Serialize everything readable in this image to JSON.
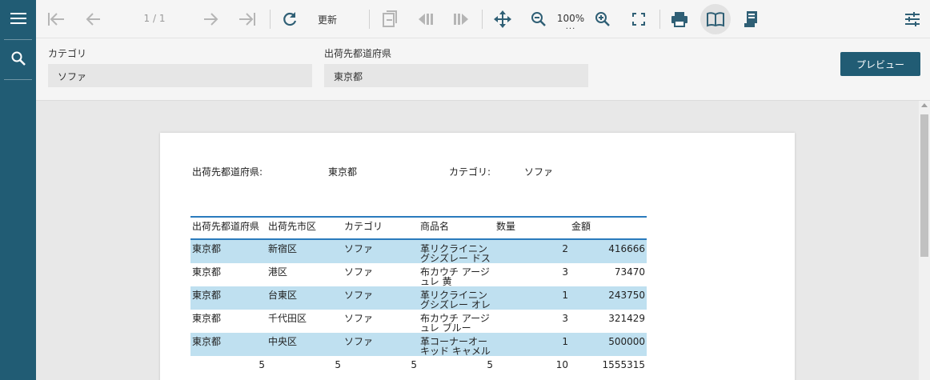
{
  "toolbar": {
    "page_indicator": "1 / 1",
    "refresh_label": "更新",
    "zoom_label": "100%",
    "zoom_more": "..."
  },
  "params": {
    "category_label": "カテゴリ",
    "category_value": "ソファ",
    "prefecture_label": "出荷先都道府県",
    "prefecture_value": "東京都",
    "preview_button": "プレビュー"
  },
  "report": {
    "header_prefecture_label": "出荷先都道府県:",
    "header_prefecture_value": "東京都",
    "header_category_label": "カテゴリ:",
    "header_category_value": "ソファ",
    "columns": [
      "出荷先都道府県",
      "出荷先市区",
      "カテゴリ",
      "商品名",
      "数量",
      "金額"
    ],
    "rows": [
      [
        "東京都",
        "新宿区",
        "ソファ",
        "革リクライニングシズレー ドスタチ",
        "2",
        "416666"
      ],
      [
        "東京都",
        "港区",
        "ソファ",
        "布カウチ アージュレ 黄",
        "3",
        "73470"
      ],
      [
        "東京都",
        "台東区",
        "ソファ",
        "革リクライニングシズレー オレンジ",
        "1",
        "243750"
      ],
      [
        "東京都",
        "千代田区",
        "ソファ",
        "布カウチ アージュレ ブルー",
        "3",
        "321429"
      ],
      [
        "東京都",
        "中央区",
        "ソファ",
        "革コーナーオーキッド キャメル",
        "1",
        "500000"
      ]
    ],
    "totals": [
      "5",
      "5",
      "5",
      "5",
      "10",
      "1555315"
    ]
  }
}
